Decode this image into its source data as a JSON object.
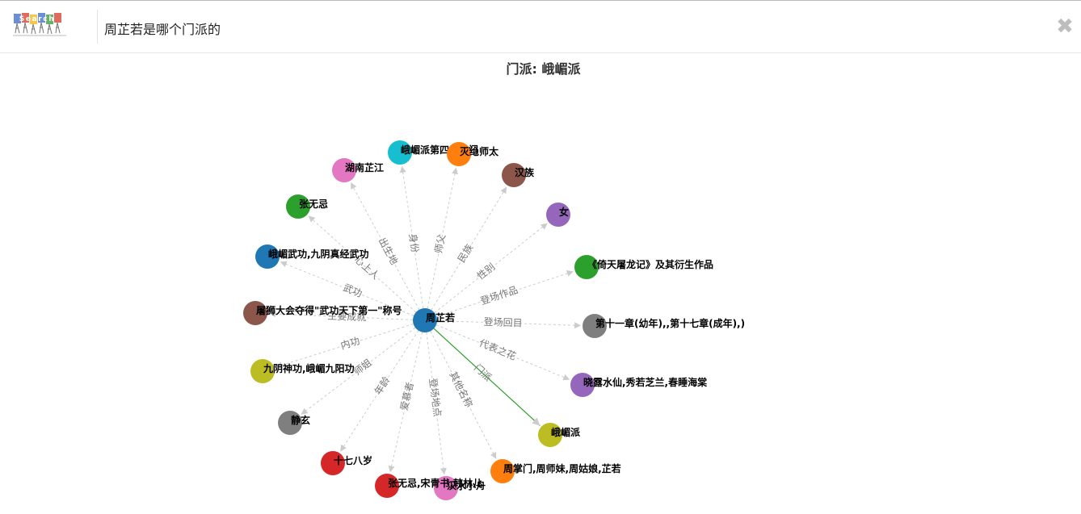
{
  "query": "周芷若是哪个门派的",
  "logo_text": "Search",
  "close_icon": "close-icon",
  "title": "门派: 峨嵋派",
  "colors": {
    "edge": "#cccccc",
    "edge_highlight": "#2ca02c",
    "arrow": "#cccccc"
  },
  "center": {
    "name": "周芷若",
    "color": "#1f77b4"
  },
  "relations": [
    {
      "relation": "身份",
      "target": "峨嵋派第四代掌门",
      "color": "#17becf"
    },
    {
      "relation": "师父",
      "target": "灭绝师太",
      "color": "#ff7f0e"
    },
    {
      "relation": "民族",
      "target": "汉族",
      "color": "#8c564b"
    },
    {
      "relation": "性别",
      "target": "女",
      "color": "#9467bd"
    },
    {
      "relation": "登场作品",
      "target": "《倚天屠龙记》及其衍生作品",
      "color": "#2ca02c"
    },
    {
      "relation": "登场回目",
      "target": "第十一章(幼年),,第十七章(成年),)",
      "color": "#7f7f7f"
    },
    {
      "relation": "代表之花",
      "target": "晓露水仙,秀若芝兰,春睡海棠",
      "color": "#9467bd"
    },
    {
      "relation": "门派",
      "target": "峨嵋派",
      "color": "#bcbd22",
      "highlight": true
    },
    {
      "relation": "其他名称",
      "target": "周掌门,周师妹,周姑娘,芷若",
      "color": "#ff7f0e"
    },
    {
      "relation": "登场地点",
      "target": "汉水小舟",
      "color": "#e377c2"
    },
    {
      "relation": "爱慕者",
      "target": "张无忌,宋青书,韩林儿",
      "color": "#d62728"
    },
    {
      "relation": "年龄",
      "target": "十七八岁",
      "color": "#d62728"
    },
    {
      "relation": "师姐",
      "target": "静玄",
      "color": "#7f7f7f"
    },
    {
      "relation": "内功",
      "target": "九阴神功,峨嵋九阳功",
      "color": "#bcbd22"
    },
    {
      "relation": "主要成就",
      "target": "屠狮大会夺得\"武功天下第一\"称号",
      "color": "#8c564b"
    },
    {
      "relation": "武功",
      "target": "峨嵋武功,九阴真经武功",
      "color": "#1f77b4"
    },
    {
      "relation": "心上人",
      "target": "张无忌",
      "color": "#2ca02c"
    },
    {
      "relation": "出生地",
      "target": "湖南芷江",
      "color": "#e377c2"
    }
  ]
}
